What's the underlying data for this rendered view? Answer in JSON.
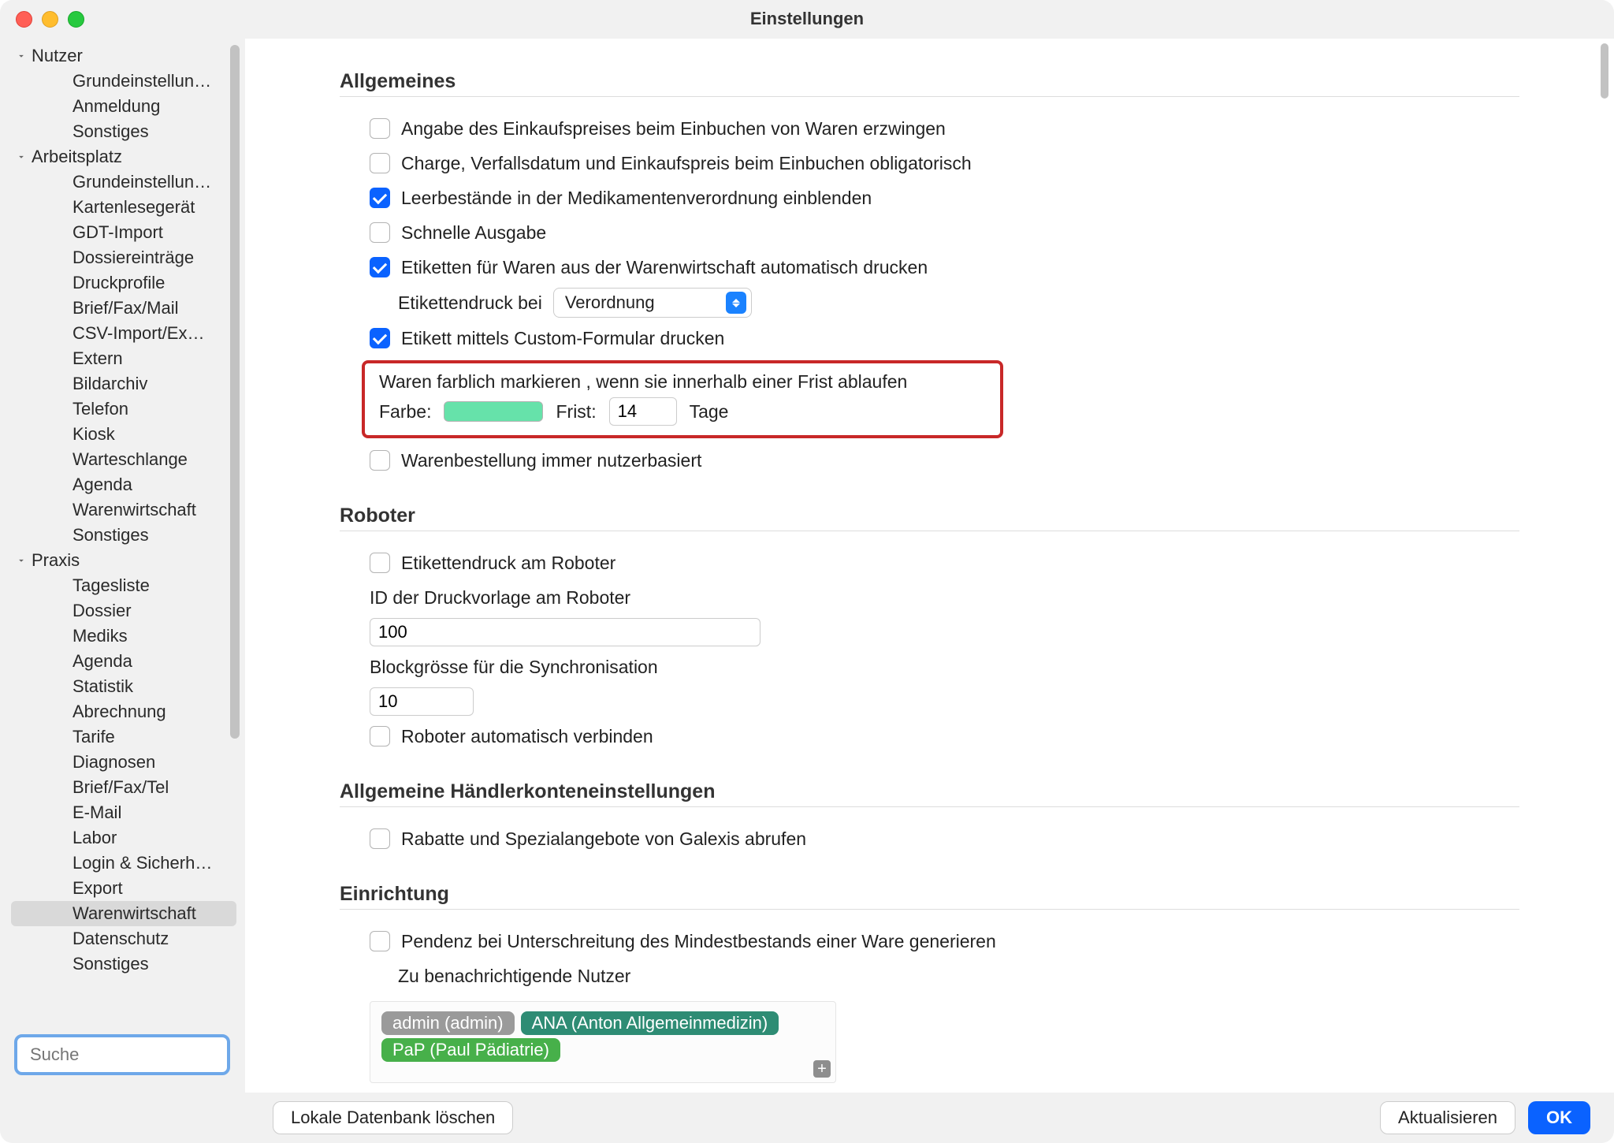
{
  "window_title": "Einstellungen",
  "sidebar": {
    "groups": [
      {
        "label": "Nutzer",
        "items": [
          "Grundeinstellun…",
          "Anmeldung",
          "Sonstiges"
        ]
      },
      {
        "label": "Arbeitsplatz",
        "items": [
          "Grundeinstellun…",
          "Kartenlesegerät",
          "GDT-Import",
          "Dossiereinträge",
          "Druckprofile",
          "Brief/Fax/Mail",
          "CSV-Import/Ex…",
          "Extern",
          "Bildarchiv",
          "Telefon",
          "Kiosk",
          "Warteschlange",
          "Agenda",
          "Warenwirtschaft",
          "Sonstiges"
        ]
      },
      {
        "label": "Praxis",
        "items": [
          "Tagesliste",
          "Dossier",
          "Mediks",
          "Agenda",
          "Statistik",
          "Abrechnung",
          "Tarife",
          "Diagnosen",
          "Brief/Fax/Tel",
          "E-Mail",
          "Labor",
          "Login & Sicherh…",
          "Export",
          "Warenwirtschaft",
          "Datenschutz",
          "Sonstiges"
        ]
      }
    ],
    "selected": "Praxis.Warenwirtschaft",
    "search_placeholder": "Suche"
  },
  "sections": {
    "allgemeines": {
      "title": "Allgemeines",
      "chk_einkaufspreis": {
        "label": "Angabe des Einkaufspreises beim Einbuchen von Waren erzwingen",
        "checked": false
      },
      "chk_charge": {
        "label": "Charge, Verfallsdatum und Einkaufspreis beim Einbuchen obligatorisch",
        "checked": false
      },
      "chk_leerbestaende": {
        "label": "Leerbestände in der Medikamentenverordnung einblenden",
        "checked": true
      },
      "chk_schnelle": {
        "label": "Schnelle Ausgabe",
        "checked": false
      },
      "chk_etiketten_auto": {
        "label": "Etiketten für Waren aus der Warenwirtschaft automatisch drucken",
        "checked": true
      },
      "etikettendruck_label": "Etikettendruck bei",
      "etikettendruck_value": "Verordnung",
      "chk_custom": {
        "label": "Etikett mittels Custom-Formular drucken",
        "checked": true
      },
      "mark_text": "Waren farblich markieren , wenn sie innerhalb einer Frist ablaufen",
      "farbe_label": "Farbe:",
      "farbe_value": "#66e2aa",
      "frist_label": "Frist:",
      "frist_value": "14",
      "tage_label": "Tage",
      "chk_nutzerbasiert": {
        "label": "Warenbestellung immer nutzerbasiert",
        "checked": false
      }
    },
    "roboter": {
      "title": "Roboter",
      "chk_etikett": {
        "label": "Etikettendruck am Roboter",
        "checked": false
      },
      "id_label": "ID der Druckvorlage am Roboter",
      "id_value": "100",
      "block_label": "Blockgrösse für die Synchronisation",
      "block_value": "10",
      "chk_auto": {
        "label": "Roboter automatisch verbinden",
        "checked": false
      }
    },
    "haendler": {
      "title": "Allgemeine Händlerkonteneinstellungen",
      "chk_galexis": {
        "label": "Rabatte und Spezialangebote von Galexis abrufen",
        "checked": false
      }
    },
    "einrichtung": {
      "title": "Einrichtung",
      "chk_pendenz": {
        "label": "Pendenz bei Unterschreitung des Mindestbestands einer Ware generieren",
        "checked": false
      },
      "notify_label": "Zu benachrichtigende Nutzer",
      "tags": [
        {
          "text": "admin (admin)",
          "cls": "gray"
        },
        {
          "text": "ANA (Anton Allgemeinmedizin)",
          "cls": "teal"
        },
        {
          "text": "PaP (Paul Pädiatrie)",
          "cls": "green"
        }
      ]
    }
  },
  "footer": {
    "db_btn": "Lokale Datenbank löschen",
    "refresh": "Aktualisieren",
    "ok": "OK"
  }
}
